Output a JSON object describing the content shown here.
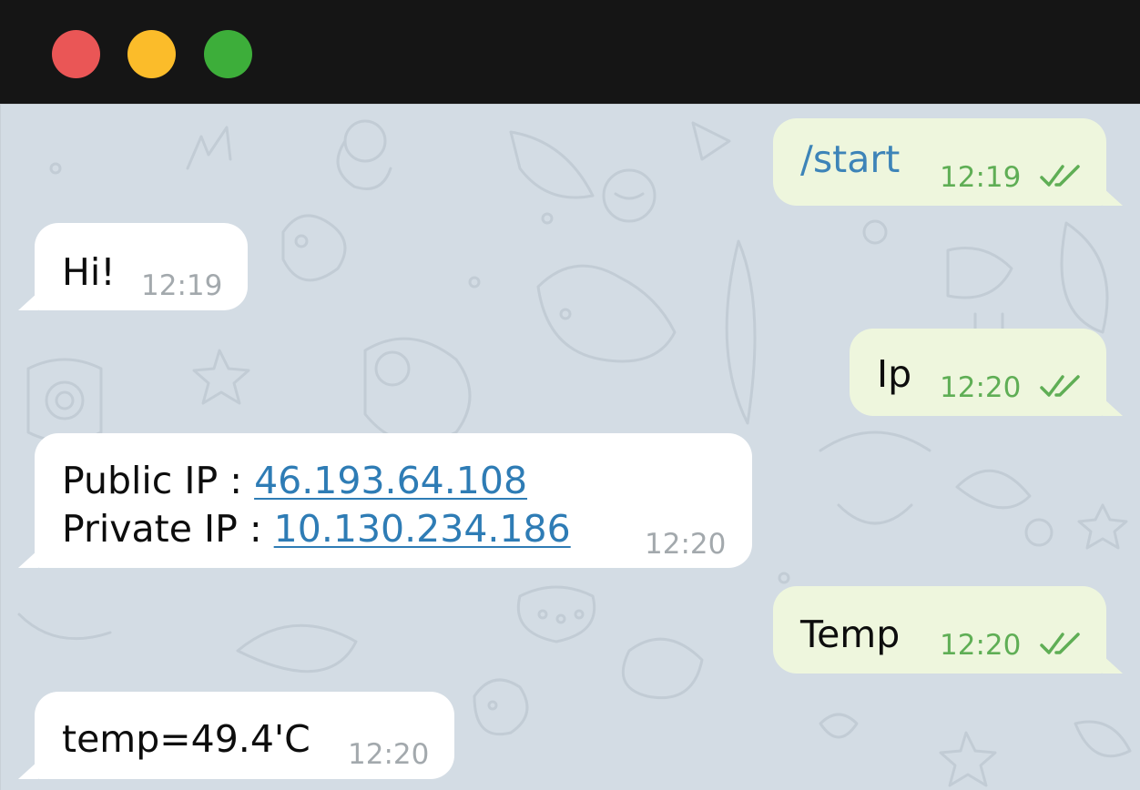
{
  "window": {
    "buttons": [
      "close",
      "minimize",
      "maximize"
    ],
    "colors": {
      "titlebar": "#151515",
      "close": "#ea5656",
      "minimize": "#fbbc2a",
      "maximize": "#3dae3a",
      "chat_background": "#d3dce4",
      "incoming_bubble": "#ffffff",
      "outgoing_bubble": "#eef6dd",
      "outgoing_time": "#5fae55",
      "link": "#2e7cb5"
    }
  },
  "messages": [
    {
      "direction": "outgoing",
      "text": "/start",
      "time": "12:19",
      "status": "read"
    },
    {
      "direction": "incoming",
      "text": "Hi!",
      "time": "12:19"
    },
    {
      "direction": "outgoing",
      "text": "Ip",
      "time": "12:20",
      "status": "read"
    },
    {
      "direction": "incoming",
      "lines": [
        {
          "label": "Public IP : ",
          "link": "46.193.64.108"
        },
        {
          "label": "Private IP : ",
          "link": "10.130.234.186"
        }
      ],
      "time": "12:20"
    },
    {
      "direction": "outgoing",
      "text": "Temp",
      "time": "12:20",
      "status": "read"
    },
    {
      "direction": "incoming",
      "text": "temp=49.4'C",
      "time": "12:20"
    }
  ],
  "icons": {
    "read_receipt": "double-check-icon"
  }
}
